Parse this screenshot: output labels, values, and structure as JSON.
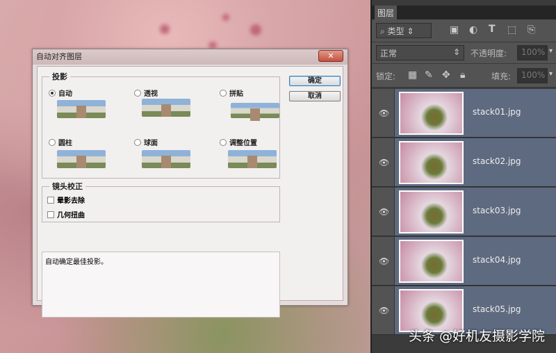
{
  "dialog": {
    "title": "自动对齐图层",
    "close": "✕",
    "projection_legend": "投影",
    "options": [
      {
        "label": "自动",
        "selected": true
      },
      {
        "label": "透视",
        "selected": false
      },
      {
        "label": "拼贴",
        "selected": false
      },
      {
        "label": "圆柱",
        "selected": false
      },
      {
        "label": "球面",
        "selected": false
      },
      {
        "label": "调整位置",
        "selected": false
      }
    ],
    "ok": "确定",
    "cancel": "取消",
    "lens_legend": "镜头校正",
    "lens_options": [
      {
        "label": "晕影去除",
        "checked": false
      },
      {
        "label": "几何扭曲",
        "checked": false
      }
    ],
    "description": "自动确定最佳投影。"
  },
  "panel": {
    "tab": "图层",
    "filter": "类型",
    "blend_mode": "正常",
    "opacity_label": "不透明度:",
    "opacity": "100%",
    "lock_label": "锁定:",
    "fill_label": "填充:",
    "fill": "100%",
    "layers": [
      "stack01.jpg",
      "stack02.jpg",
      "stack03.jpg",
      "stack04.jpg",
      "stack05.jpg"
    ]
  },
  "watermark": "头条 @好机友摄影学院"
}
